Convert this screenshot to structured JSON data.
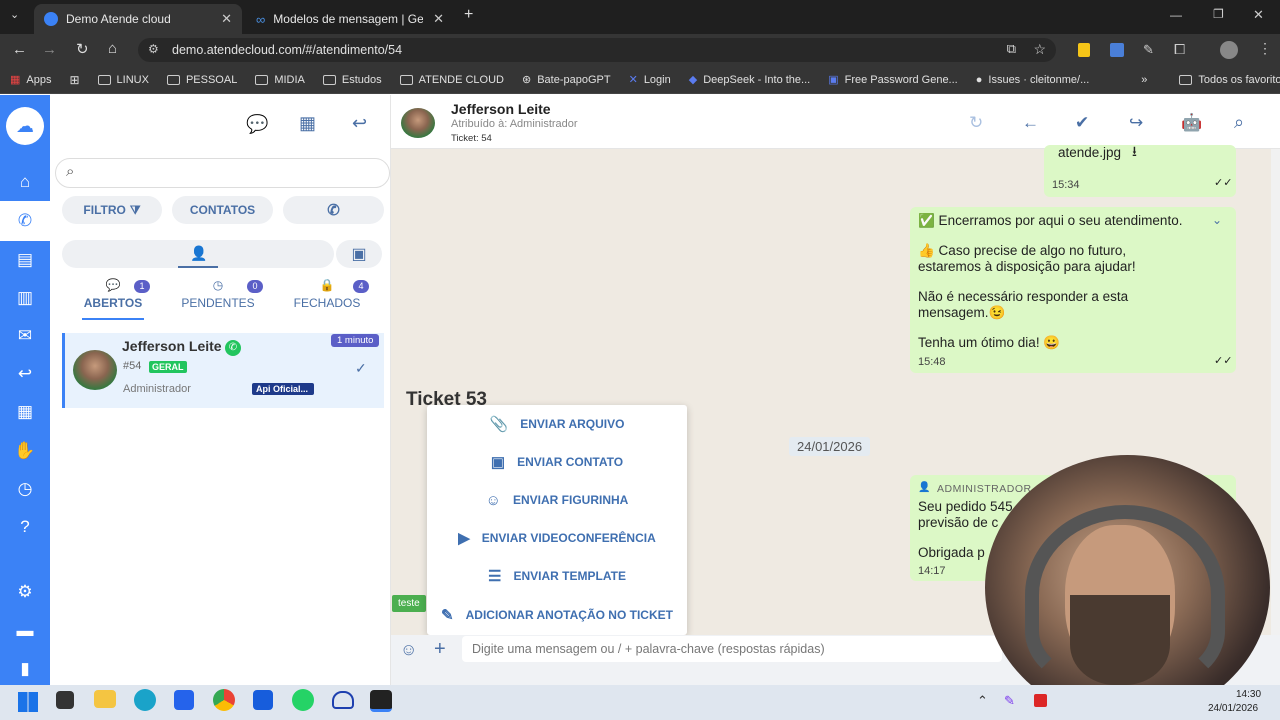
{
  "browser": {
    "tabs": [
      {
        "title": "Demo Atende cloud",
        "active": true
      },
      {
        "title": "Modelos de mensagem | Gerenc",
        "active": false
      }
    ],
    "url": "demo.atendecloud.com/#/atendimento/54",
    "bookmarks": [
      "Apps",
      "LINUX",
      "PESSOAL",
      "MIDIA",
      "Estudos",
      "ATENDE CLOUD",
      "Bate-papoGPT",
      "Login",
      "DeepSeek - Into the...",
      "Free Password Gene...",
      "Issues · cleitonme/...",
      "Todos os favoritos"
    ]
  },
  "left": {
    "filters": {
      "filter": "FILTRO",
      "contacts": "CONTATOS"
    },
    "tabs": [
      {
        "label": "ABERTOS",
        "count": "1"
      },
      {
        "label": "PENDENTES",
        "count": "0"
      },
      {
        "label": "FECHADOS",
        "count": "4"
      }
    ],
    "ticket": {
      "name": "Jefferson Leite",
      "number": "#54",
      "queue": "GERAL",
      "time": "1 minuto",
      "assignee": "Administrador",
      "channel": "Api Oficial..."
    }
  },
  "header": {
    "name": "Jefferson Leite",
    "assigned": "Atribuído à: Administrador",
    "ticket": "Ticket: 54"
  },
  "chat": {
    "file": {
      "name": "atende.jpg",
      "time": "15:34"
    },
    "closing": {
      "line1": "✅ Encerramos por aqui o seu atendimento.",
      "line2": "👍 Caso precise de algo no futuro, estaremos à disposição para ajudar!",
      "line3": "Não é necessário responder a esta mensagem.😉",
      "line4": "Tenha um ótimo dia! 😀",
      "time": "15:48"
    },
    "divider": "Ticket 53",
    "date": "24/01/2026",
    "admin_msg": {
      "author": "ADMINISTRADOR",
      "text1": "Seu pedido 545",
      "text2": "previsão de c",
      "text3": "Obrigada p",
      "time": "14:17"
    },
    "tag": "teste"
  },
  "menu": [
    "ENVIAR ARQUIVO",
    "ENVIAR CONTATO",
    "ENVIAR FIGURINHA",
    "ENVIAR VIDEOCONFERÊNCIA",
    "ENVIAR TEMPLATE",
    "ADICIONAR ANOTAÇÃO NO TICKET"
  ],
  "input": {
    "placeholder": "Digite uma mensagem ou / + palavra-chave (respostas rápidas)"
  },
  "taskbar": {
    "time": "14:30",
    "date": "24/01/2026"
  }
}
